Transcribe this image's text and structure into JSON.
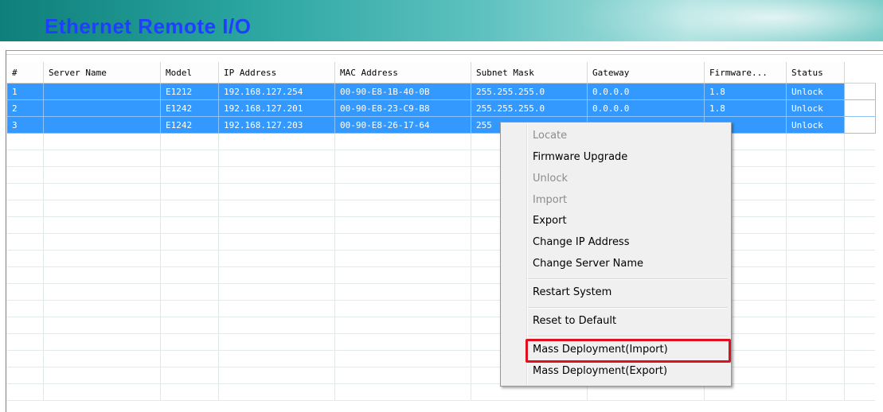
{
  "banner": {
    "title": "Ethernet Remote I/O"
  },
  "table": {
    "headers": [
      "#",
      "Server Name",
      "Model",
      "IP Address",
      "MAC Address",
      "Subnet Mask",
      "Gateway",
      "Firmware...",
      "Status"
    ],
    "rows": [
      {
        "num": "1",
        "server_name": "",
        "model": "E1212",
        "ip": "192.168.127.254",
        "mac": "00-90-E8-1B-40-0B",
        "subnet": "255.255.255.0",
        "gateway": "0.0.0.0",
        "firmware": "1.8",
        "status": "Unlock"
      },
      {
        "num": "2",
        "server_name": "",
        "model": "E1242",
        "ip": "192.168.127.201",
        "mac": "00-90-E8-23-C9-B8",
        "subnet": "255.255.255.0",
        "gateway": "0.0.0.0",
        "firmware": "1.8",
        "status": "Unlock"
      },
      {
        "num": "3",
        "server_name": "",
        "model": "E1242",
        "ip": "192.168.127.203",
        "mac": "00-90-E8-26-17-64",
        "subnet": "255",
        "gateway": "",
        "firmware": "",
        "status": "Unlock"
      }
    ]
  },
  "context_menu": {
    "locate": "Locate",
    "firmware_upgrade": "Firmware Upgrade",
    "unlock": "Unlock",
    "import": "Import",
    "export": "Export",
    "change_ip": "Change IP Address",
    "change_server_name": "Change Server Name",
    "restart_system": "Restart System",
    "reset_default": "Reset to Default",
    "mass_import": "Mass Deployment(Import)",
    "mass_export": "Mass Deployment(Export)"
  },
  "colors": {
    "selection": "#3399ff",
    "title": "#1f3fff",
    "highlight_box": "#e01020"
  }
}
